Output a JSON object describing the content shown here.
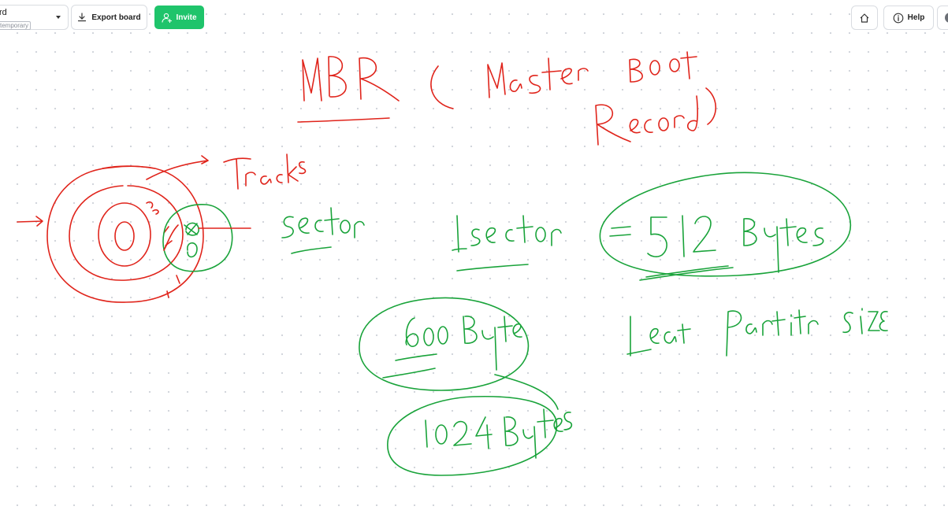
{
  "toolbar": {
    "board_name": "rd",
    "board_badge": "temporary",
    "export_label": "Export board",
    "invite_label": "Invite",
    "help_label": "Help",
    "icons": {
      "board_menu": "chevron-down-icon",
      "export": "download-icon",
      "invite": "add-user-icon",
      "home": "home-icon",
      "help": "info-icon",
      "avatar": "avatar-icon"
    }
  },
  "colors": {
    "invite_button": "#1fc46b",
    "ink_red": "#e0241b",
    "ink_green": "#19a33a",
    "canvas_dots": "#cfd3da"
  },
  "canvas": {
    "handwriting": [
      {
        "text": "MBR ( Master Boot Record )",
        "color": "red"
      },
      {
        "text": "Tracks",
        "color": "red"
      },
      {
        "text": "Sector",
        "color": "green"
      },
      {
        "text": "1 sector",
        "color": "green"
      },
      {
        "text": "= 512 Bytes",
        "color": "green"
      },
      {
        "text": "600 Bytes",
        "color": "green"
      },
      {
        "text": "Least Partition Size",
        "color": "green"
      },
      {
        "text": "1024 Bytes",
        "color": "green"
      }
    ]
  }
}
